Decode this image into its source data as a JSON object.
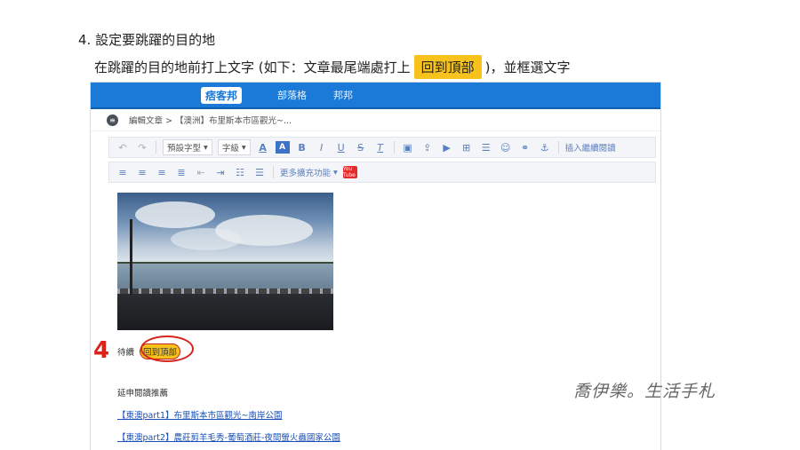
{
  "step_heading": "4. 設定要跳躍的目的地",
  "instruction": {
    "before": "在跳躍的目的地前打上文字 (如下：文章最尾端處打上",
    "highlight": "回到頂部",
    "after": ")，並框選文字"
  },
  "app": {
    "logo": "痞客邦",
    "nav": [
      "部落格",
      "邦邦"
    ],
    "breadcrumb": "編輯文章 > 【澳洲】布里斯本市區觀光~...",
    "toolbar_row1": {
      "font_select": "預設字型",
      "size_select": "字級",
      "insert_label": "插入繼續閱讀"
    },
    "toolbar_row2": {
      "more_label": "更多擴充功能",
      "youtube_label": "You Tube"
    },
    "editor": {
      "wait_text": "待續",
      "anchor_text": "回到頂部",
      "related_title": "延申閱讀推薦",
      "links": [
        "【東澳part1】布里斯本市區觀光~南岸公園",
        "【東澳part2】農莊剪羊毛秀-葡萄酒莊-夜間螢火蟲國家公園"
      ]
    }
  },
  "annotation_number": "4",
  "watermark": "喬伊樂。生活手札",
  "colors": {
    "highlight": "#f7c21b",
    "topbar": "#1b7ad8",
    "annotation": "#e0211a"
  }
}
